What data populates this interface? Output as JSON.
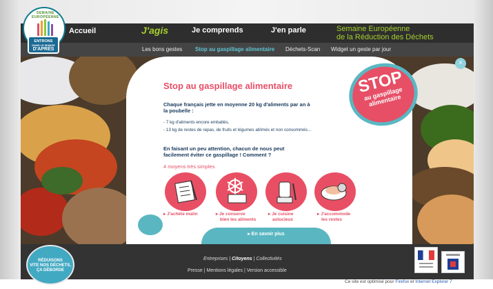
{
  "logo": {
    "ring_text": "SEMAINE EUROPÉENNE",
    "badge_line1": "ENTRONS",
    "badge_line2": "DANS LE MONDE",
    "badge_line3": "D'APRÈS"
  },
  "nav": {
    "accueil": "Accueil",
    "jagis": "J'agis",
    "jecomprends": "Je comprends",
    "jenparle": "J'en parle",
    "semaine_line1": "Semaine Européenne",
    "semaine_line2": "de la Réduction des Déchets"
  },
  "subnav": {
    "item1": "Les bons gestes",
    "item2": "Stop au gaspillage alimentaire",
    "item3": "Déchets-Scan",
    "item4": "Widget un geste par jour"
  },
  "panel": {
    "title": "Stop au gaspillage alimentaire",
    "intro": "Chaque français jette en moyenne 20 kg d'aliments par an à la poubelle :",
    "list1": "- 7 kg d'aliments encore emballés,",
    "list2": "- 13 kg de restes de repas, de fruits et légumes abîmés et non consommés...",
    "question": "En faisant un peu attention, chacun de nous peut facilement éviter ce gaspillage ! Comment ?",
    "moyens": "4 moyens très simples",
    "c1_label1": "▸ J'achète malin",
    "c2_label1": "▸ Je conserve",
    "c2_label2": "bien les aliments",
    "c3_label1": "▸ Je cuisine",
    "c3_label2": "astucieux",
    "c4_label1": "▸ J'accommode",
    "c4_label2": "les restes",
    "ensavoir": "▸ En savoir plus"
  },
  "stop": {
    "big": "STOP",
    "line1": "au gaspillage",
    "line2": "alimentaire",
    "close": "×"
  },
  "footer": {
    "entreprises": "Entreprises",
    "citoyens": "Citoyens",
    "collectivites": "Collectivités",
    "sep": " | ",
    "presse": "Presse",
    "mentions": "Mentions légales",
    "version": "Version accessible",
    "reduisons_1": "RÉDUISONS",
    "reduisons_2": "VITE NOS DÉCHETS,",
    "reduisons_3": "ÇA DÉBORDE",
    "optim_prefix": "Ce site est optimisé pour ",
    "firefox": "Firefox",
    "et": " et ",
    "ie": "Internet Explorer 7"
  }
}
